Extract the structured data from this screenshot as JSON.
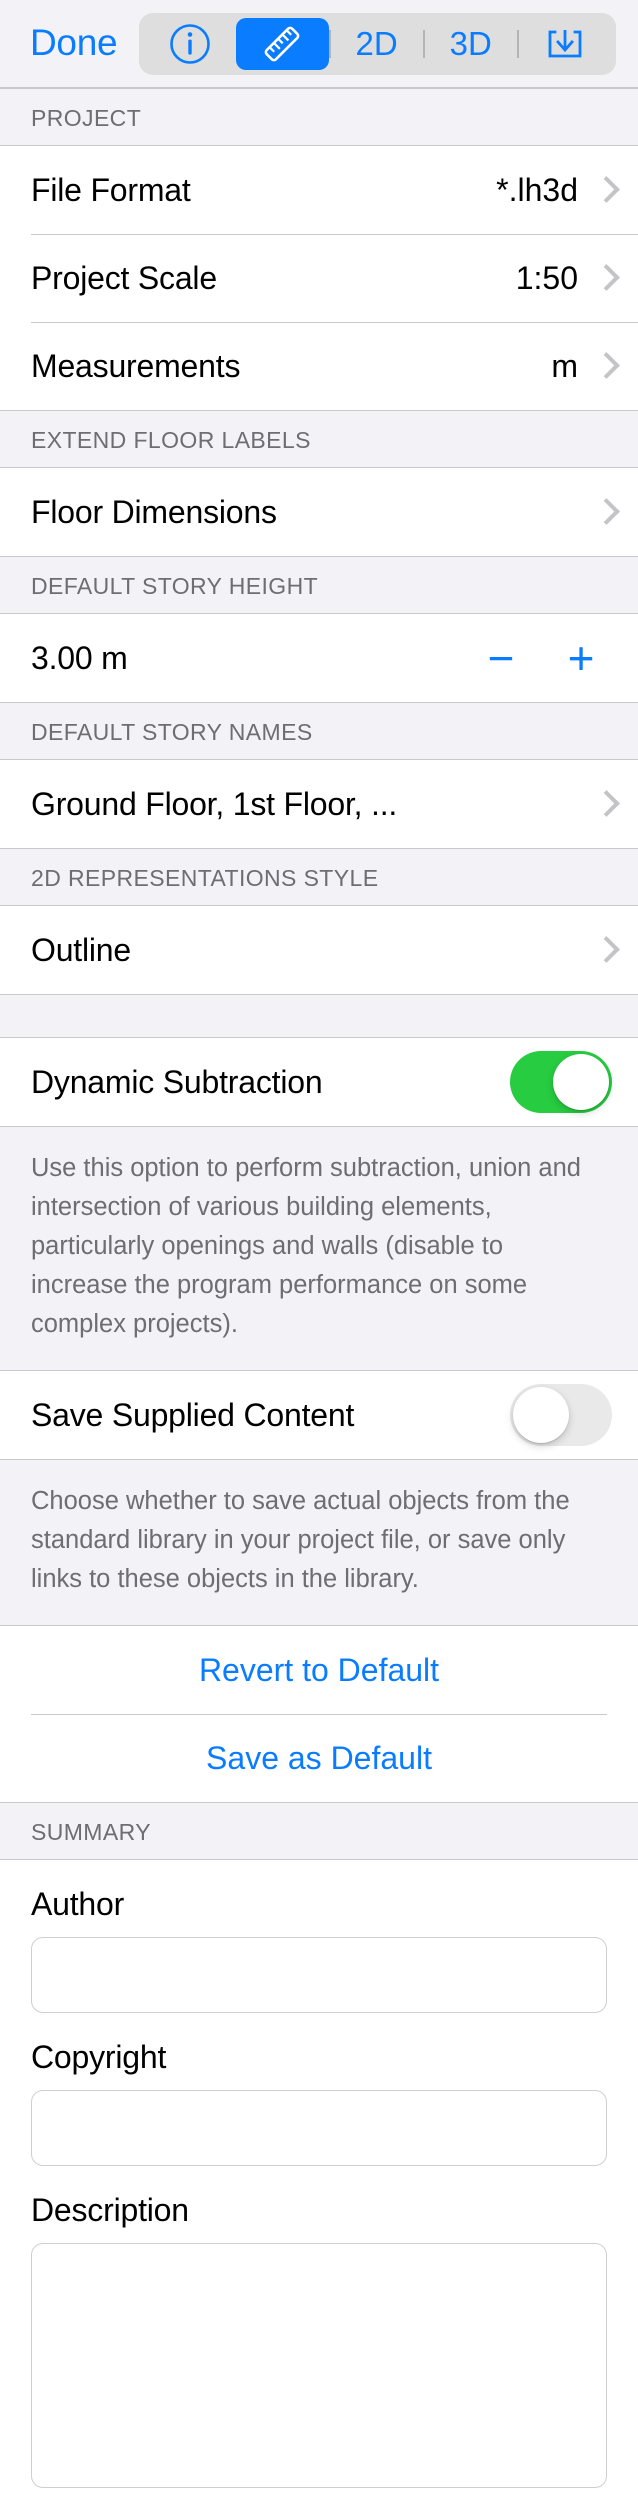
{
  "toolbar": {
    "done_label": "Done",
    "segments": [
      {
        "id": "info",
        "icon": "info-circle-icon",
        "label": "",
        "active": false
      },
      {
        "id": "ruler",
        "icon": "ruler-icon",
        "label": "",
        "active": true
      },
      {
        "id": "view2d",
        "icon": "",
        "label": "2D",
        "active": false
      },
      {
        "id": "view3d",
        "icon": "",
        "label": "3D",
        "active": false
      },
      {
        "id": "export",
        "icon": "export-download-icon",
        "label": "",
        "active": false
      }
    ],
    "accent_color": "#0a7cff",
    "segment_bg_color": "#dededf"
  },
  "sections": {
    "project": {
      "header": "PROJECT",
      "rows": [
        {
          "label": "File Format",
          "value": "*.lh3d"
        },
        {
          "label": "Project Scale",
          "value": "1:50"
        },
        {
          "label": "Measurements",
          "value": "m"
        }
      ]
    },
    "extend_floor_labels": {
      "header": "EXTEND FLOOR LABELS",
      "rows": [
        {
          "label": "Floor Dimensions",
          "value": ""
        }
      ]
    },
    "default_story_height": {
      "header": "DEFAULT STORY HEIGHT",
      "value": "3.00 m",
      "minus_label": "−",
      "plus_label": "+"
    },
    "default_story_names": {
      "header": "DEFAULT STORY NAMES",
      "rows": [
        {
          "label": "Ground Floor, 1st Floor, ...",
          "value": ""
        }
      ]
    },
    "representations_style": {
      "header": "2D REPRESENTATIONS STYLE",
      "rows": [
        {
          "label": "Outline",
          "value": ""
        }
      ]
    },
    "dynamic_subtraction": {
      "label": "Dynamic Subtraction",
      "state": "on",
      "on_color": "#27cc41",
      "footnote": "Use this option to perform subtraction, union and intersection of various building elements, particularly openings and walls (disable to increase the program performance on some complex projects)."
    },
    "save_supplied_content": {
      "label": "Save Supplied Content",
      "state": "off",
      "off_color": "#e9e9ea",
      "footnote": "Choose whether to save actual objects from the standard library in your project file, or save only links to these objects in the library."
    },
    "actions": {
      "revert_label": "Revert to Default",
      "save_label": "Save as Default"
    },
    "summary": {
      "header": "SUMMARY",
      "author_label": "Author",
      "author_value": "",
      "author_placeholder": "",
      "copyright_label": "Copyright",
      "copyright_value": "",
      "copyright_placeholder": "",
      "description_label": "Description",
      "description_value": "",
      "description_placeholder": ""
    }
  }
}
